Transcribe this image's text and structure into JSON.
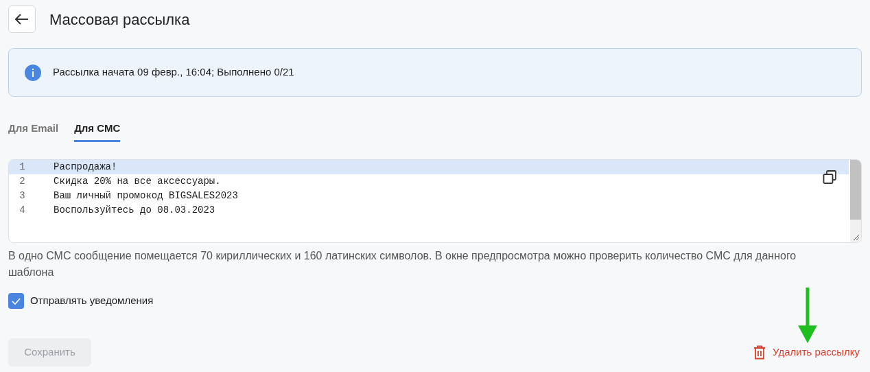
{
  "header": {
    "title": "Массовая рассылка"
  },
  "banner": {
    "text": "Рассылка начата 09 февр., 16:04; Выполнено 0/21"
  },
  "tabs": [
    {
      "label": "Для Email",
      "selected": false
    },
    {
      "label": "Для СМС",
      "selected": true
    }
  ],
  "editor": {
    "lines": [
      {
        "number": "1",
        "text": "Распродажа!",
        "selected": true
      },
      {
        "number": "2",
        "text": "Скидка 20% на все аксессуары.",
        "selected": false
      },
      {
        "number": "3",
        "text": "Ваш личный промокод BIGSALES2023",
        "selected": false
      },
      {
        "number": "4",
        "text": "Воспользуйтесь до 08.03.2023",
        "selected": false
      }
    ]
  },
  "hint": "В одно СМС сообщение помещается 70 кириллических и 160 латинских символов. В окне предпросмотра можно проверить количество СМС для данного шаблона",
  "notify": {
    "label": "Отправлять уведомления",
    "checked": true
  },
  "save_button": {
    "label": "Сохранить",
    "disabled": true
  },
  "delete_link": {
    "label": "Удалить рассылку"
  }
}
